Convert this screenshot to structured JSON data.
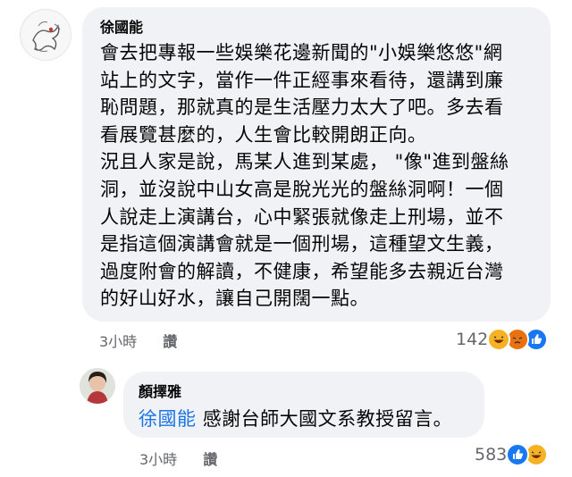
{
  "comment1": {
    "author": "徐國能",
    "lines": [
      "會去把專報一些娛樂花邊新聞的\"小娛樂悠悠\"網",
      "站上的文字，當作一件正經事來看待，還講到廉",
      "恥問題，那就真的是生活壓力太大了吧。多去看",
      "看展覽甚麼的，人生會比較開朗正向。",
      "況且人家是說，馬某人進到某處， \"像\"進到盤絲",
      "洞，並沒說中山女高是脫光光的盤絲洞啊！一個",
      "人說走上演講台，心中緊張就像走上刑場，並不",
      "是指這個演講會就是一個刑場，這種望文生義，",
      "過度附會的解讀，不健康，希望能多去親近台灣",
      "的好山好水，讓自己開闊一點。"
    ],
    "time": "3小時",
    "reply": "讚",
    "reaction_count": "142",
    "reactions": [
      "haha-icon",
      "angry-icon",
      "like-icon"
    ]
  },
  "comment2": {
    "author": "顏擇雅",
    "mention": "徐國能",
    "text": "感謝台師大國文系教授留言。",
    "time": "3小時",
    "reply": "讚",
    "reaction_count": "583",
    "reactions": [
      "like-icon",
      "haha-icon"
    ]
  },
  "colors": {
    "bubble": "#f0f2f5",
    "mention": "#1b74e4",
    "meta": "#65676b",
    "like": "#1877f2",
    "haha": "#f7b125",
    "angry": "#e9710f"
  }
}
